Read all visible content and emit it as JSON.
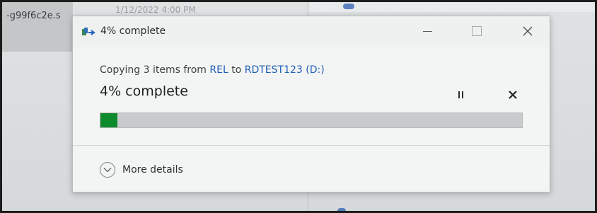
{
  "background": {
    "filename_fragment": "-g99f6c2e.s",
    "date_fragment": "1/12/2022 4:00 PM"
  },
  "dialog": {
    "title": "4% complete",
    "copy_prefix": "Copying 3 items from ",
    "source": "REL",
    "copy_middle": " to ",
    "destination": "RDTEST123 (D:)",
    "status": "4% complete",
    "progress_fraction": 0.04,
    "more_details_label": "More details",
    "icons": {
      "app": "copy-files-icon",
      "minimize": "minimize-icon",
      "maximize": "maximize-icon",
      "close": "close-icon",
      "pause": "pause-icon",
      "cancel": "cancel-icon",
      "expand": "chevron-down-icon"
    },
    "colors": {
      "progress": "#0d8a2c",
      "link": "#1f5fb8"
    }
  }
}
